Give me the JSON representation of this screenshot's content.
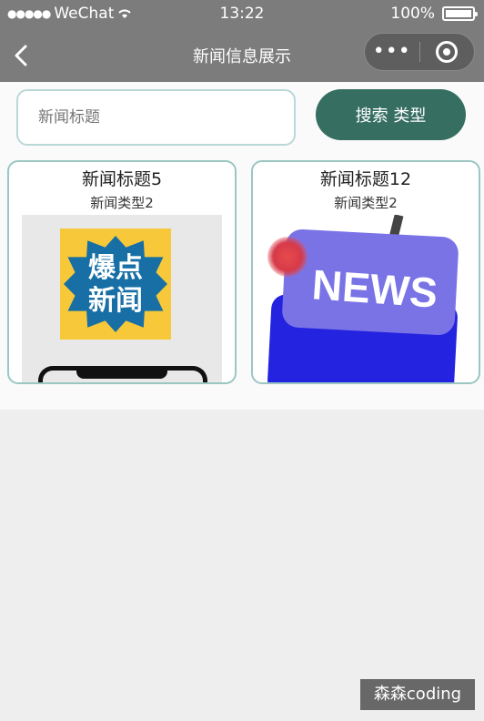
{
  "status_bar": {
    "carrier": "WeChat",
    "signal_dots": "●●●●●",
    "time": "13:22",
    "battery": "100%"
  },
  "nav": {
    "title": "新闻信息展示",
    "more_glyph": "•••"
  },
  "search": {
    "placeholder": "新闻标题",
    "button_label": "搜索 类型"
  },
  "cards": [
    {
      "title": "新闻标题5",
      "type": "新闻类型2",
      "image_text": "爆点\n新闻"
    },
    {
      "title": "新闻标题12",
      "type": "新闻类型2",
      "image_text": "NEWS"
    }
  ],
  "watermark": "森森coding",
  "colors": {
    "nav_bg": "#7c7c7c",
    "button_bg": "#366e62",
    "card_border": "#9bc6c2",
    "page_bg": "#efeeef"
  }
}
